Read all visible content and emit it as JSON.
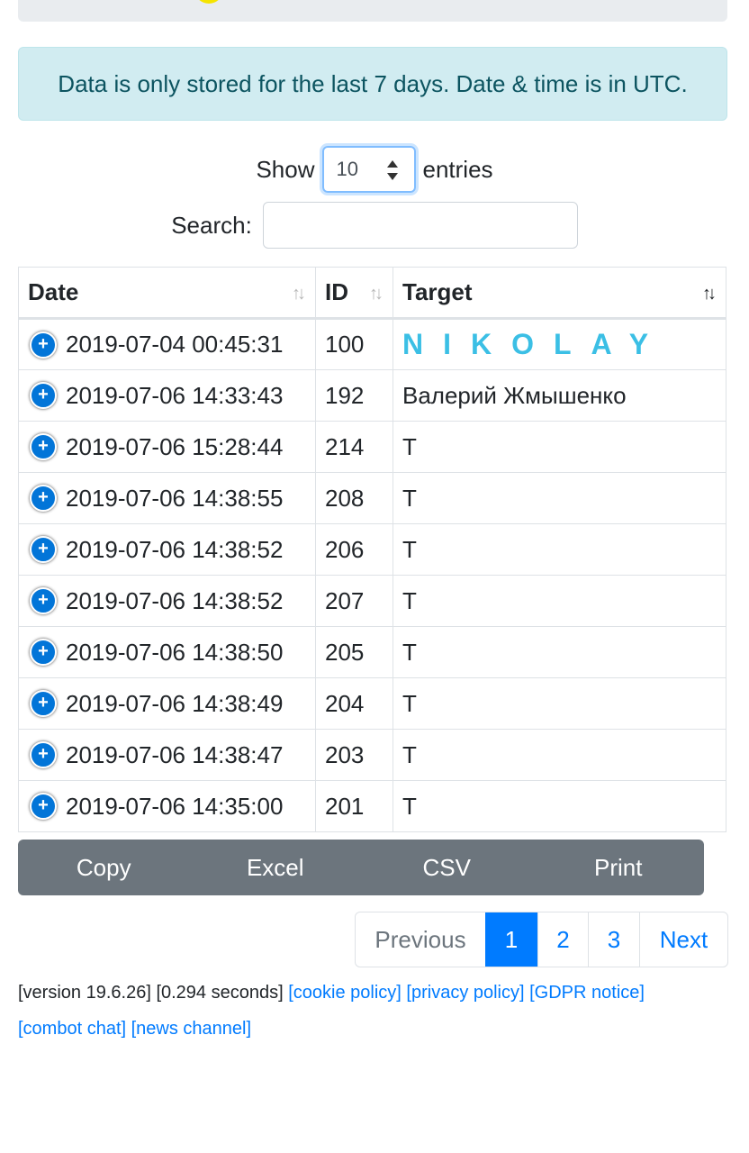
{
  "notice": "Data is only stored for the last 7 days. Date & time is in UTC.",
  "length": {
    "show_label": "Show",
    "selected": "10",
    "entries_label": "entries"
  },
  "search": {
    "label": "Search:",
    "value": ""
  },
  "table": {
    "headers": {
      "date": "Date",
      "id": "ID",
      "target": "Target"
    },
    "rows": [
      {
        "date": "2019-07-04 00:45:31",
        "id": "100",
        "target": "NIKOLAY"
      },
      {
        "date": "2019-07-06 14:33:43",
        "id": "192",
        "target": "Валерий Жмышенко"
      },
      {
        "date": "2019-07-06 15:28:44",
        "id": "214",
        "target": "T"
      },
      {
        "date": "2019-07-06 14:38:55",
        "id": "208",
        "target": "T"
      },
      {
        "date": "2019-07-06 14:38:52",
        "id": "206",
        "target": "T"
      },
      {
        "date": "2019-07-06 14:38:52",
        "id": "207",
        "target": "T"
      },
      {
        "date": "2019-07-06 14:38:50",
        "id": "205",
        "target": "T"
      },
      {
        "date": "2019-07-06 14:38:49",
        "id": "204",
        "target": "T"
      },
      {
        "date": "2019-07-06 14:38:47",
        "id": "203",
        "target": "T"
      },
      {
        "date": "2019-07-06 14:35:00",
        "id": "201",
        "target": "T"
      }
    ]
  },
  "buttons": {
    "copy": "Copy",
    "excel": "Excel",
    "csv": "CSV",
    "print": "Print"
  },
  "pagination": {
    "previous": "Previous",
    "pages": [
      "1",
      "2",
      "3"
    ],
    "next": "Next",
    "current": "1"
  },
  "footer": {
    "version": "[version 19.6.26]",
    "timing": "[0.294 seconds]",
    "cookie": "[cookie policy]",
    "privacy": "[privacy policy]",
    "gdpr": "[GDPR notice]",
    "combot": "[combot chat]",
    "news": "[news channel]"
  },
  "icons": {
    "row_expand": "plus-circle-icon",
    "sort": "sort-arrows-icon",
    "select": "select-arrows-icon"
  },
  "colors": {
    "primary": "#007bff",
    "info_bg": "#d1ecf1",
    "info_text": "#0c5460",
    "button_bg": "#6c757d",
    "logo": "#3bbfe5"
  }
}
